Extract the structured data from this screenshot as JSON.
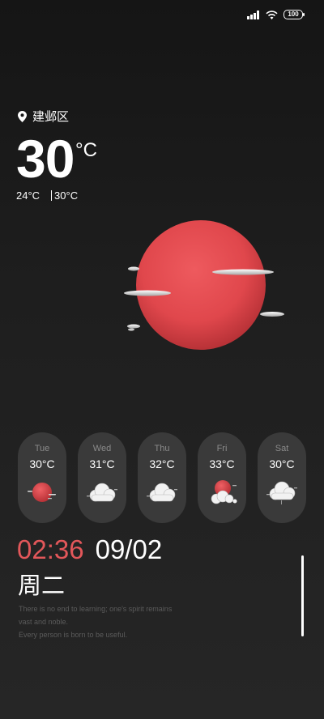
{
  "status": {
    "battery": "100"
  },
  "location": {
    "name": "建邺区"
  },
  "current": {
    "temp": "30",
    "unit": "°C",
    "low": "24°C",
    "high": "30°C"
  },
  "forecast": [
    {
      "day": "Tue",
      "temp": "30°C",
      "icon": "sunny-icon"
    },
    {
      "day": "Wed",
      "temp": "31°C",
      "icon": "cloudy-icon"
    },
    {
      "day": "Thu",
      "temp": "32°C",
      "icon": "cloudy-icon"
    },
    {
      "day": "Fri",
      "temp": "33°C",
      "icon": "partly-cloudy-icon"
    },
    {
      "day": "Sat",
      "temp": "30°C",
      "icon": "rain-cloud-icon"
    }
  ],
  "clock": {
    "time": "02:36",
    "date": "09/02",
    "weekday": "周二"
  },
  "quote": {
    "line1": "There is no end to learning; one's spirit remains",
    "line2": "vast and noble.",
    "line3": "Every person is born to be useful."
  },
  "colors": {
    "accent": "#e2575a",
    "card": "#3a3a3a"
  }
}
